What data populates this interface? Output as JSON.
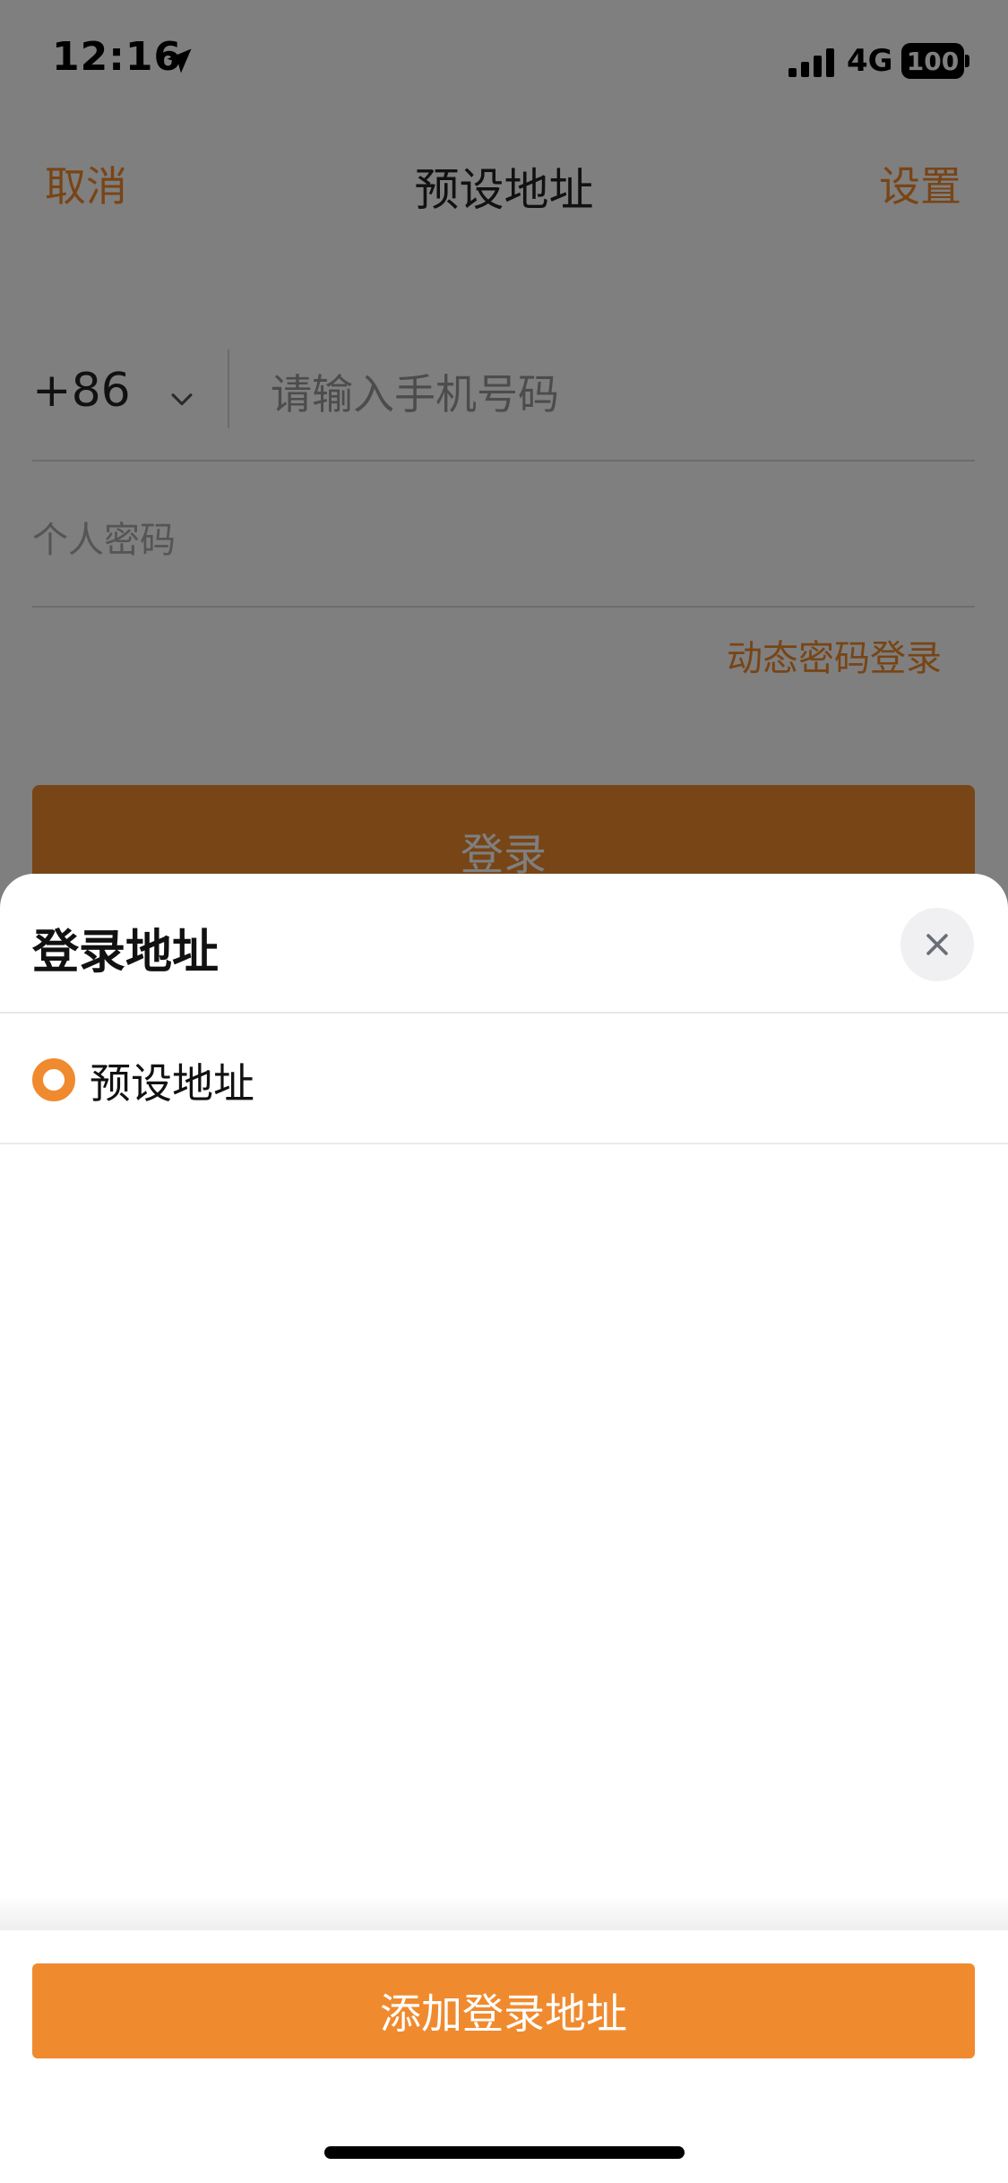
{
  "status_bar": {
    "time": "12:16",
    "network": "4G",
    "battery": "100"
  },
  "nav": {
    "cancel": "取消",
    "title": "预设地址",
    "settings": "设置"
  },
  "login_form": {
    "country_code": "+86",
    "phone_placeholder": "请输入手机号码",
    "password_placeholder": "个人密码",
    "dynamic_login": "动态密码登录",
    "login_button": "登录"
  },
  "sheet": {
    "title": "登录地址",
    "items": [
      {
        "label": "预设地址",
        "selected": true
      }
    ],
    "add_button": "添加登录地址"
  },
  "colors": {
    "accent": "#f08a2e",
    "overlay": "rgba(0,0,0,0.5)"
  },
  "icons": [
    "location-arrow-icon",
    "signal-icon",
    "battery-icon",
    "chevron-down-icon",
    "close-icon",
    "radio-selected-icon"
  ]
}
